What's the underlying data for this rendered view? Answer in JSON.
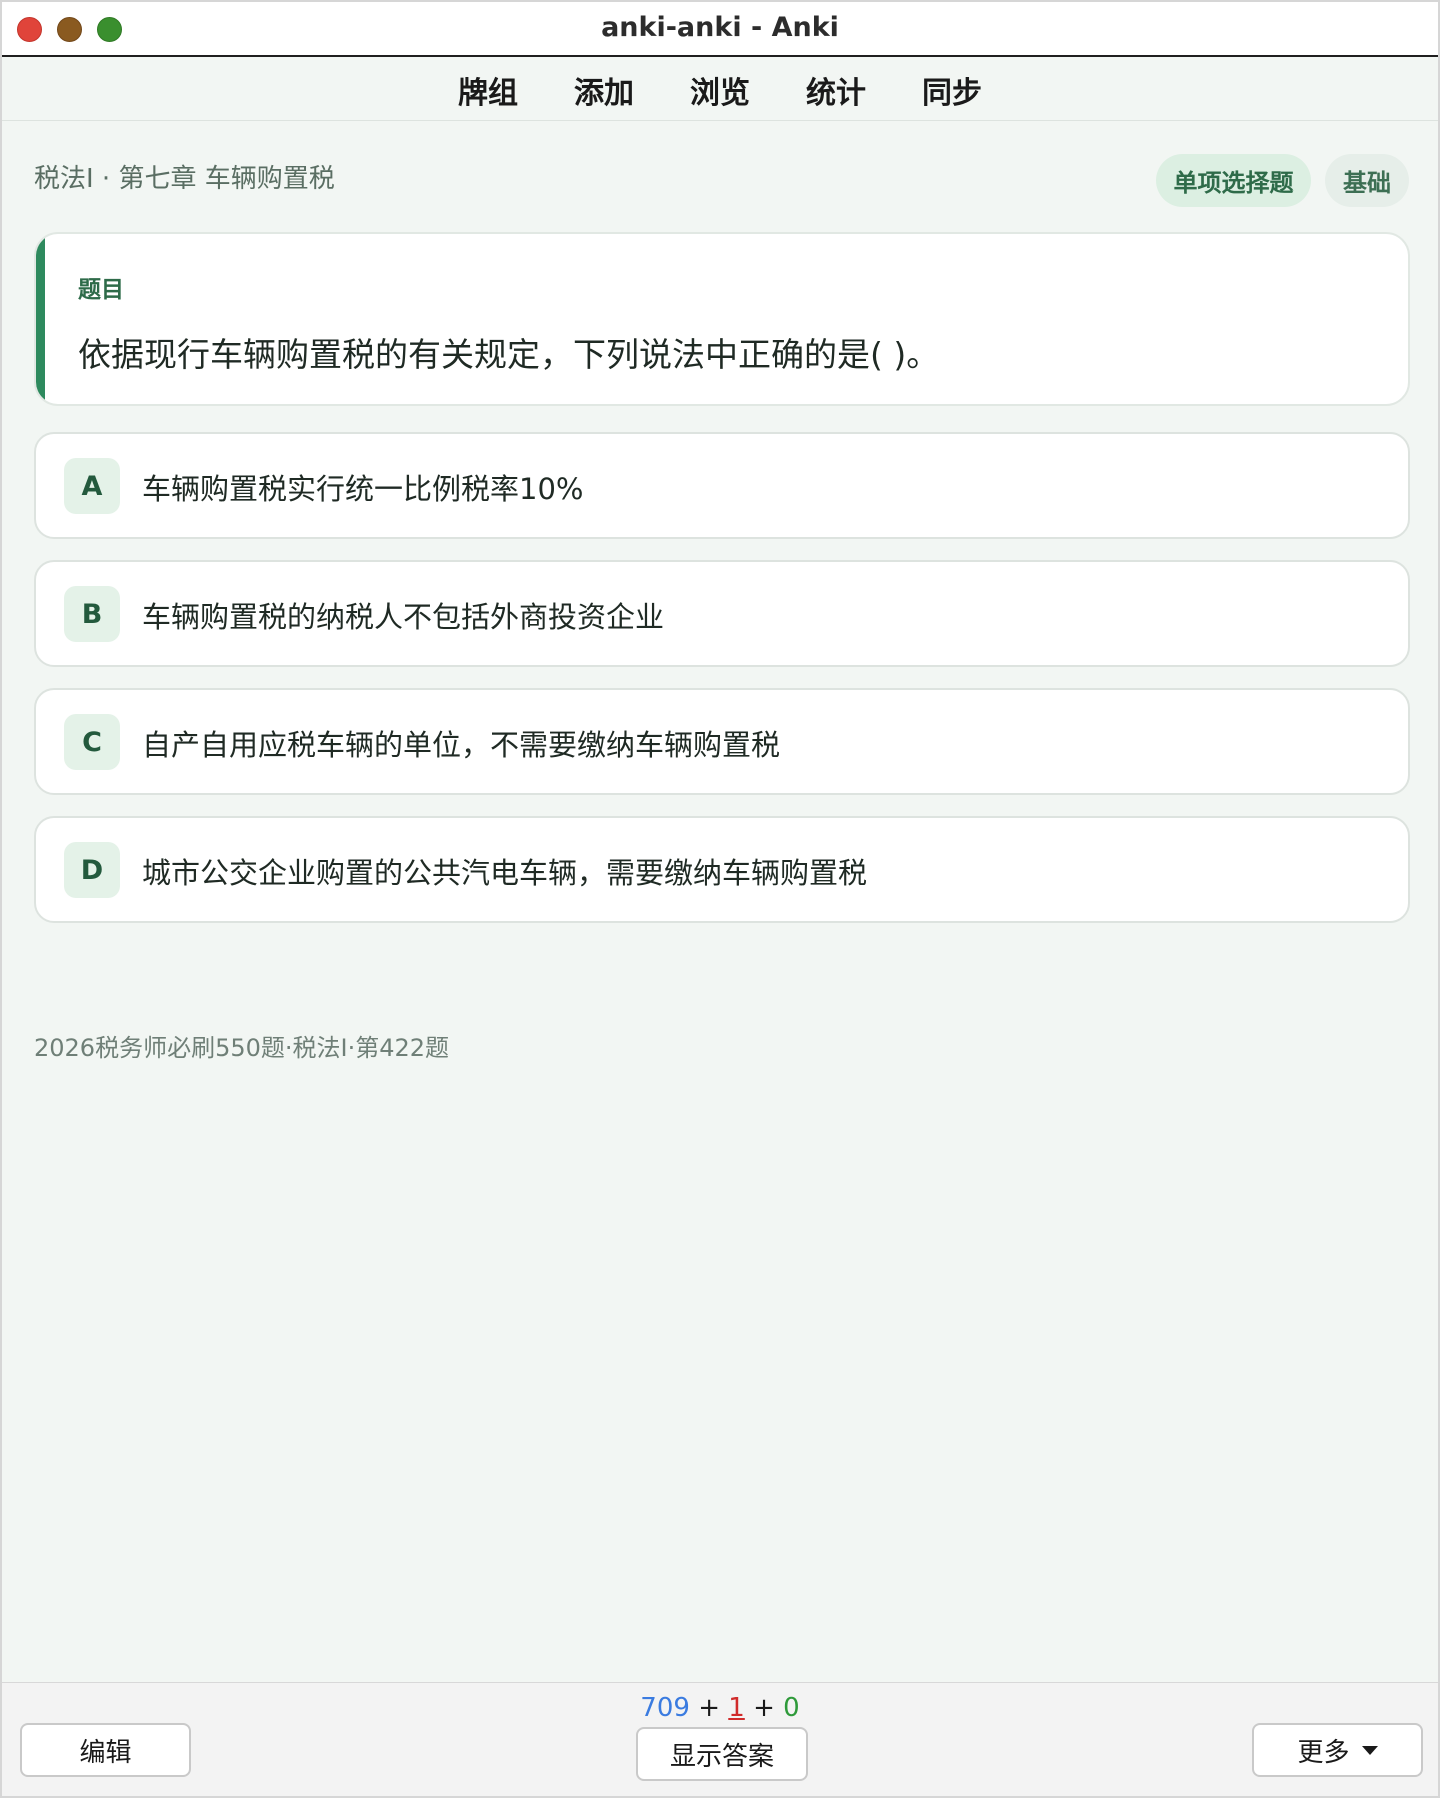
{
  "window": {
    "title": "anki-anki - Anki"
  },
  "toolbar": {
    "items": [
      "牌组",
      "添加",
      "浏览",
      "统计",
      "同步"
    ]
  },
  "card": {
    "breadcrumb": "税法I · 第七章 车辆购置税",
    "tags": {
      "type": "单项选择题",
      "level": "基础"
    },
    "question_label": "题目",
    "question_text": "依据现行车辆购置税的有关规定，下列说法中正确的是( )。",
    "options": [
      {
        "letter": "A",
        "text": "车辆购置税实行统一比例税率10%"
      },
      {
        "letter": "B",
        "text": "车辆购置税的纳税人不包括外商投资企业"
      },
      {
        "letter": "C",
        "text": "自产自用应税车辆的单位，不需要缴纳车辆购置税"
      },
      {
        "letter": "D",
        "text": "城市公交企业购置的公共汽电车辆，需要缴纳车辆购置税"
      }
    ],
    "source": "2026税务师必刷550题·税法I·第422题"
  },
  "bottom": {
    "counts": {
      "new": "709",
      "sep1": " + ",
      "learn": "1",
      "sep2": " + ",
      "review": "0"
    },
    "colors": {
      "new": "#3a7be0",
      "learn": "#d02b2b",
      "review": "#2e9a3a"
    },
    "edit_label": "编辑",
    "show_answer_label": "显示答案",
    "more_label": "更多"
  }
}
